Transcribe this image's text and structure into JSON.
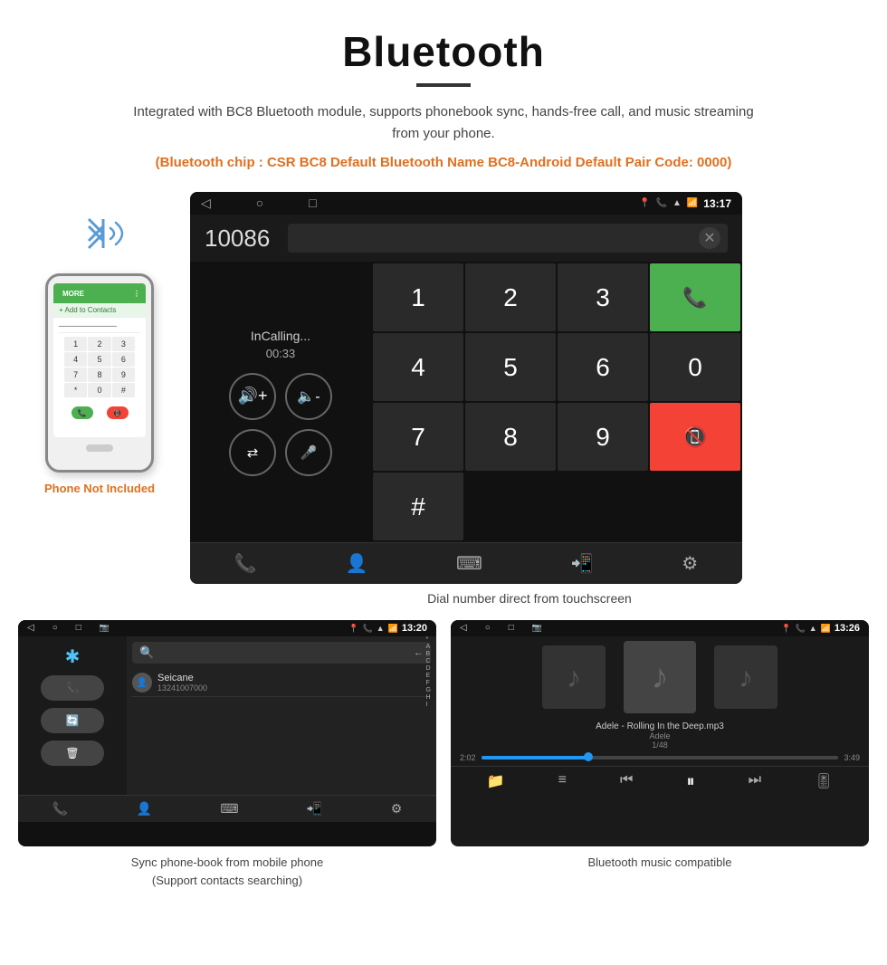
{
  "header": {
    "title": "Bluetooth",
    "subtitle": "Integrated with BC8 Bluetooth module, supports phonebook sync, hands-free call, and music streaming from your phone.",
    "info_line": "(Bluetooth chip : CSR BC8    Default Bluetooth Name BC8-Android    Default Pair Code: 0000)"
  },
  "dialer_screen": {
    "time": "13:17",
    "number": "10086",
    "call_status": "InCalling...",
    "call_duration": "00:33",
    "keys": [
      "1",
      "2",
      "3",
      "*",
      "4",
      "5",
      "6",
      "0",
      "7",
      "8",
      "9",
      "#"
    ],
    "call_accept": "📞",
    "call_reject": "📵"
  },
  "dialer_caption": "Dial number direct from touchscreen",
  "phonebook_screen": {
    "time": "13:20",
    "contact_name": "Seicane",
    "contact_number": "13241007000",
    "alpha": [
      "*",
      "A",
      "B",
      "C",
      "D",
      "E",
      "F",
      "G",
      "H",
      "I"
    ]
  },
  "phonebook_caption": "Sync phone-book from mobile phone\n(Support contacts searching)",
  "music_screen": {
    "time": "13:26",
    "track": "Adele - Rolling In the Deep.mp3",
    "artist": "Adele",
    "position": "1/48",
    "current_time": "2:02",
    "total_time": "3:49",
    "progress_percent": 30
  },
  "music_caption": "Bluetooth music compatible",
  "phone_not_included": "Phone Not Included"
}
